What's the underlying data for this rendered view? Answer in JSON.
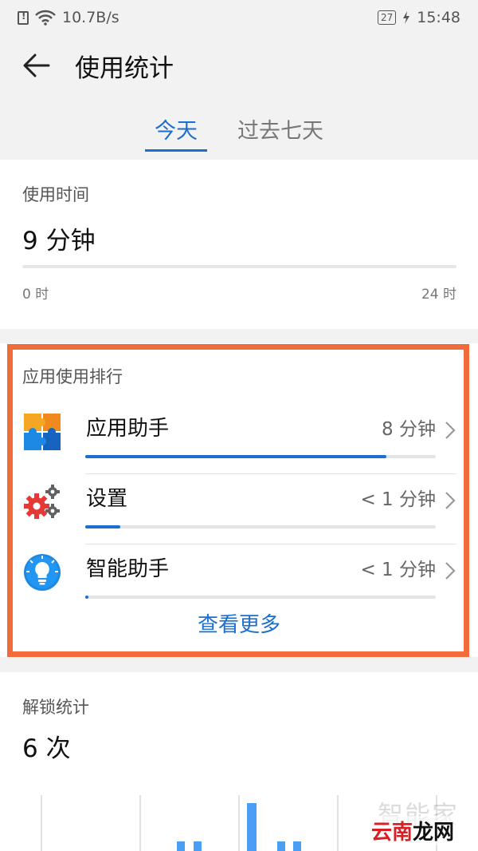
{
  "status_bar": {
    "net_speed": "10.7B/s",
    "battery": "27",
    "time": "15:48"
  },
  "app_bar": {
    "title": "使用统计"
  },
  "tabs": [
    {
      "label": "今天",
      "active": true
    },
    {
      "label": "过去七天",
      "active": false
    }
  ],
  "usage": {
    "label": "使用时间",
    "value": "9 分钟",
    "axis_start": "0 时",
    "axis_end": "24 时"
  },
  "ranking": {
    "label": "应用使用排行",
    "items": [
      {
        "name": "应用助手",
        "time": "8 分钟",
        "fraction": 0.86,
        "icon": "puzzle-icon"
      },
      {
        "name": "设置",
        "time": "< 1 分钟",
        "fraction": 0.1,
        "icon": "gear-icon"
      },
      {
        "name": "智能助手",
        "time": "< 1 分钟",
        "fraction": 0.01,
        "icon": "lightbulb-icon"
      }
    ],
    "see_more": "查看更多"
  },
  "unlock": {
    "label": "解锁统计",
    "value": "6 次"
  },
  "watermark": {
    "top": "智能家",
    "bottom_red": "云南",
    "bottom_black": "龙网"
  },
  "colors": {
    "accent": "#1b6fd1",
    "highlight": "#f26b3a",
    "chart_bar": "#4a9ff5"
  }
}
